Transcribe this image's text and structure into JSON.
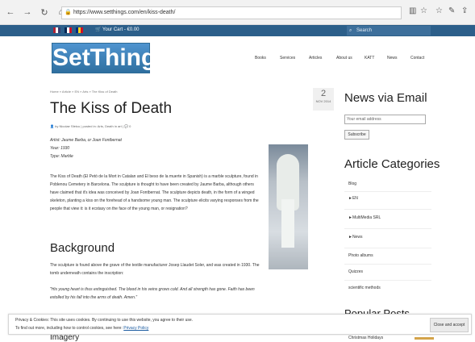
{
  "browser": {
    "url": "https://www.setthings.com/en/kiss-death/"
  },
  "topbar": {
    "cart": "Your Cart - €0.00",
    "search": "Search"
  },
  "header": {
    "logo": "SetThings",
    "nav": [
      "Books",
      "Services",
      "Articles",
      "About us",
      "KATT",
      "News",
      "Contact"
    ]
  },
  "article": {
    "breadcrumb": "Home » Article » EN » Arts » The Kiss of Death",
    "date_day": "2",
    "date_month": "NOV 2014",
    "title": "The Kiss of Death",
    "meta": "by Nicolae Sfetcu | posted in: Arts, Death in art |",
    "comments": "0",
    "artist": "Artist: Jaume Barba, or Joan Fontbernat",
    "year": "Year: 1930",
    "type": "Type: Marble",
    "paragraph": "The Kiss of Death (El Petó de la Mort in Catalan and El beso de la muerte in Spanish) is a marble sculpture, found in Poblenou Cemetery in Barcelona. The sculpture is thought to have been created by Jaume Barba, although others have claimed that it's idea was conceived by Joan Fontbernat. The sculpture depicts death, in the form of a winged skeleton, planting a kiss on the forehead of a handsome young man. The sculpture elicits varying responses from the people that view it: is it ecstasy on the face of the young man, or resignation?",
    "background_title": "Background",
    "background_text": "The sculpture is found above the grave of the textile manufacturer Josep Llaudet Soler, and was created in 1930. The tomb underneath contains the inscription:",
    "quote": "\"His young heart is thus extinguished. The blood in his veins grows cold. And all strength has gone. Faith has been extolled by his fall into the arms of death. Amen.\"",
    "imagery_title": "Imagery"
  },
  "sidebar": {
    "news_title": "News via Email",
    "email_placeholder": "Your email address",
    "subscribe": "Subscribe",
    "categories_title": "Article Categories",
    "categories": [
      "Blog",
      "►EN",
      "►MultiMedia SRL",
      "►News",
      "Photo albums",
      "Quizzes",
      "scientific methods"
    ],
    "next_title": "Popular Posts",
    "next_item": "Christmas Holidays"
  },
  "cookie": {
    "line1": "Privacy & Cookies: This site uses cookies. By continuing to use this website, you agree to their use.",
    "line2": "To find out more, including how to control cookies, see here:",
    "link": "Privacy Policy",
    "button": "Close and accept"
  },
  "colors": {
    "topbar": "#2c5f8a",
    "accent": "#4f94cf"
  }
}
